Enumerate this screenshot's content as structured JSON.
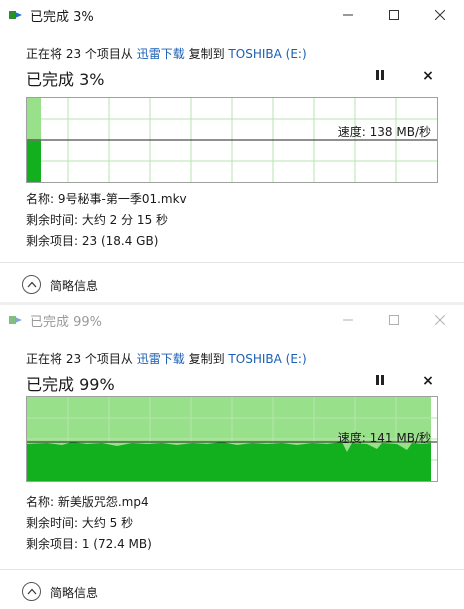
{
  "dialogs": [
    {
      "title": "已完成 3%",
      "copy_prefix": "正在将 23 个项目从",
      "source": "迅雷下载",
      "copy_mid": "复制到",
      "destination": "TOSHIBA (E:)",
      "status": "已完成 3%",
      "progress": 0.03,
      "speed": "速度: 138 MB/秒",
      "name": "名称: 9号秘事-第一季01.mkv",
      "time_left": "剩余时间: 大约 2 分 15 秒",
      "items_left": "剩余项目: 23 (18.4 GB)",
      "less_details": "简略信息",
      "active": true
    },
    {
      "title": "已完成 99%",
      "copy_prefix": "正在将 23 个项目从",
      "source": "迅雷下载",
      "copy_mid": "复制到",
      "destination": "TOSHIBA (E:)",
      "status": "已完成 99%",
      "progress": 0.99,
      "speed": "速度: 141 MB/秒",
      "name": "名称: 新美版咒怨.mp4",
      "time_left": "剩余时间: 大约 5 秒",
      "items_left": "剩余项目: 1 (72.4 MB)",
      "less_details": "简略信息",
      "active": false
    }
  ],
  "colors": {
    "fill_light": "#99e08a",
    "fill_dark": "#12b01e",
    "grid": "#b8e6b0",
    "link": "#1a5fb4"
  },
  "icons": {
    "app": "copy-arrow-icon",
    "minimize": "minimize-icon",
    "maximize": "maximize-icon",
    "close": "close-icon",
    "pause": "pause-icon",
    "stop": "stop-icon",
    "collapse": "chevron-up-icon"
  }
}
